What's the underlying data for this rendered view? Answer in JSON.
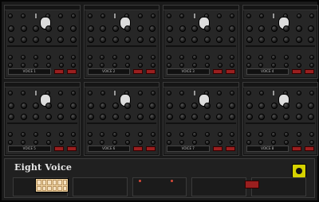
{
  "app": {
    "title": "Eight Voice"
  },
  "voices": [
    {
      "label": "VOICE 1"
    },
    {
      "label": "VOICE 2"
    },
    {
      "label": "VOICE 3"
    },
    {
      "label": "VOICE 4"
    },
    {
      "label": "VOICE 5"
    },
    {
      "label": "VOICE 6"
    },
    {
      "label": "VOICE 7"
    },
    {
      "label": "VOICE 8"
    }
  ],
  "colors": {
    "panel": "#262626",
    "accent": "#d6d200",
    "led": "#9a1f1f",
    "keys": "#f0d3a0"
  },
  "icons": {
    "brand": "tom-oberheim-icon",
    "voice_logo": "face-icon"
  }
}
